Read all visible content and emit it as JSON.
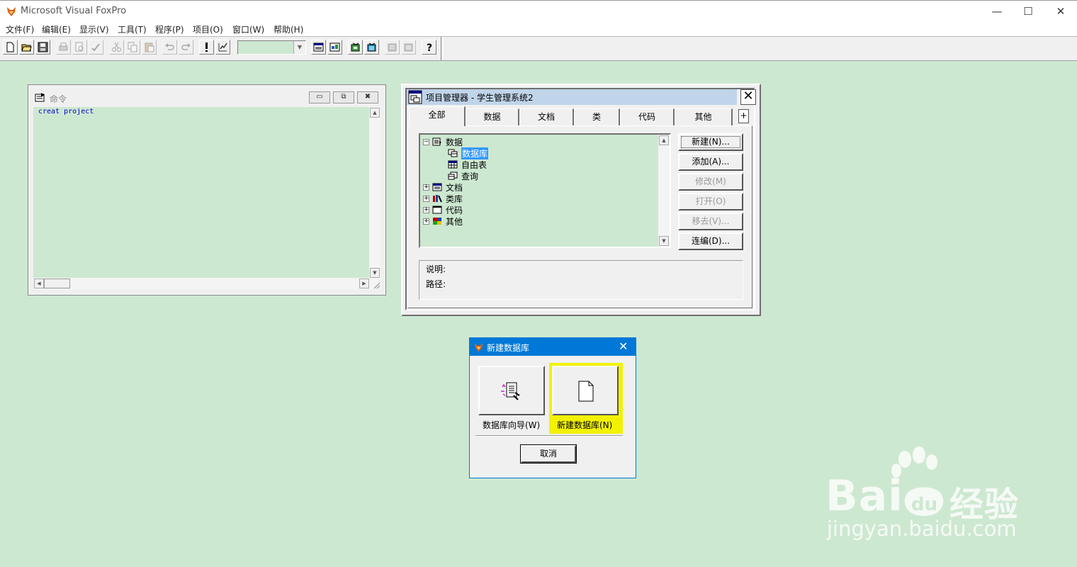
{
  "app": {
    "title": "Microsoft Visual FoxPro",
    "window_controls": {
      "minimize": "—",
      "maximize": "☐",
      "close": "✕"
    }
  },
  "menu": [
    "文件(F)",
    "编辑(E)",
    "显示(V)",
    "工具(T)",
    "程序(P)",
    "项目(O)",
    "窗口(W)",
    "帮助(H)"
  ],
  "toolbar": {
    "icons": [
      "new-icon",
      "open-icon",
      "save-icon",
      "print-icon",
      "print-preview-icon",
      "spell-check-icon",
      "cut-icon",
      "copy-icon",
      "paste-icon",
      "undo-icon",
      "redo-icon",
      "run-icon",
      "modify-form-icon",
      "command-window-icon",
      "data-session-icon",
      "form-wizard-icon",
      "report-wizard-icon",
      "autoform-icon",
      "autoreport-icon",
      "help-icon"
    ],
    "combo_value": ""
  },
  "command_window": {
    "title": "命令",
    "text": "creat project",
    "controls": {
      "minimize": "▭",
      "restore": "⧉",
      "close": "✖"
    }
  },
  "project_manager": {
    "title": "项目管理器 - 学生管理系统2",
    "close": "✕",
    "tabs": [
      "全部",
      "数据",
      "文档",
      "类",
      "代码",
      "其他"
    ],
    "tab_more": "+",
    "tree": [
      {
        "label": "数据",
        "expander": "−",
        "icon": "data-icon",
        "level": 0
      },
      {
        "label": "数据库",
        "icon": "database-icon",
        "level": 1,
        "selected": true
      },
      {
        "label": "自由表",
        "icon": "free-table-icon",
        "level": 1
      },
      {
        "label": "查询",
        "icon": "query-icon",
        "level": 1
      },
      {
        "label": "文档",
        "expander": "+",
        "icon": "documents-icon",
        "level": 0
      },
      {
        "label": "类库",
        "expander": "+",
        "icon": "class-library-icon",
        "level": 0
      },
      {
        "label": "代码",
        "expander": "+",
        "icon": "code-icon",
        "level": 0
      },
      {
        "label": "其他",
        "expander": "+",
        "icon": "other-icon",
        "level": 0
      }
    ],
    "buttons": [
      {
        "label": "新建(N)...",
        "enabled": true
      },
      {
        "label": "添加(A)...",
        "enabled": true
      },
      {
        "label": "修改(M)",
        "enabled": false
      },
      {
        "label": "打开(O)",
        "enabled": false
      },
      {
        "label": "移去(V)...",
        "enabled": false
      },
      {
        "label": "连编(D)...",
        "enabled": true
      }
    ],
    "info": {
      "description_label": "说明:",
      "path_label": "路径:"
    }
  },
  "new_database_dialog": {
    "title": "新建数据库",
    "close": "✕",
    "wizard_label": "数据库向导(W)",
    "new_label": "新建数据库(N)",
    "cancel": "取消",
    "highlight_color": "#f2f200"
  },
  "watermark": {
    "brand": "Bai",
    "brand2": "经验",
    "url": "jingyan.baidu.com"
  }
}
